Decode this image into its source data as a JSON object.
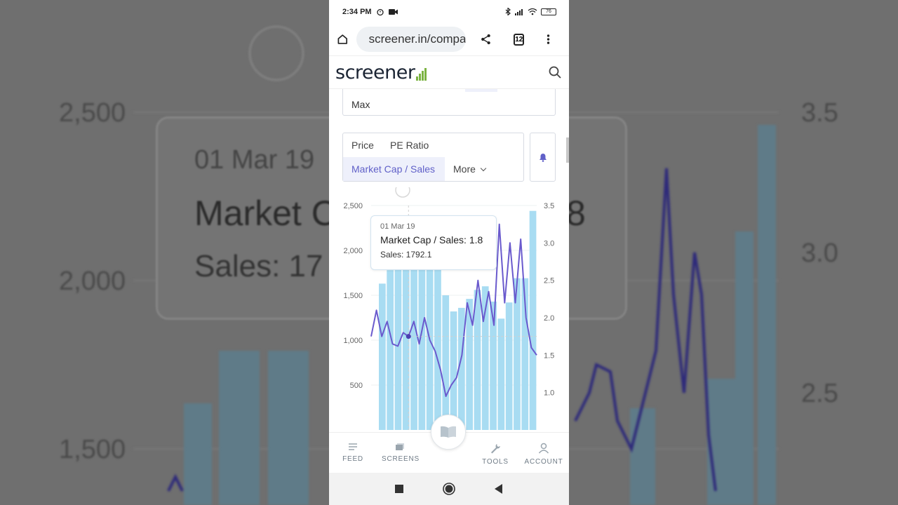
{
  "status_bar": {
    "time": "2:34 PM",
    "battery": "76"
  },
  "browser": {
    "url": "screener.in/company",
    "tab_count": "12"
  },
  "site": {
    "logo": "screener"
  },
  "filters": {
    "period_value": "Max",
    "metrics": [
      "Price",
      "PE Ratio",
      "Market Cap / Sales"
    ],
    "active_metric": "Market Cap / Sales",
    "more_label": "More"
  },
  "chart_data": {
    "type": "bar+line",
    "y_left_ticks": [
      "2,500",
      "2,000",
      "1,500",
      "1,000",
      "500"
    ],
    "y_right_ticks": [
      "3.5",
      "3.0",
      "2.5",
      "2.0",
      "1.5",
      "1.0"
    ],
    "ylim_left": [
      0,
      2500
    ],
    "ylim_right": [
      0.5,
      3.5
    ],
    "series": [
      {
        "name": "Sales",
        "type": "bar",
        "values": [
          1630,
          1780,
          1790,
          1785,
          1800,
          1830,
          1820,
          1800,
          1500,
          1320,
          1360,
          1460,
          1560,
          1600,
          1430,
          1240,
          1420,
          1690,
          1690,
          2440
        ]
      },
      {
        "name": "Market Cap / Sales",
        "type": "line",
        "values": [
          1.75,
          2.1,
          1.75,
          1.95,
          1.65,
          1.62,
          1.8,
          1.75,
          1.95,
          1.65,
          2.0,
          1.7,
          1.55,
          1.3,
          0.95,
          1.1,
          1.2,
          1.5,
          2.2,
          1.9,
          2.5,
          1.95,
          2.35,
          1.9,
          3.25,
          2.2,
          3.0,
          2.2,
          3.05,
          2.0,
          1.6,
          1.5
        ]
      }
    ],
    "tooltip": {
      "date": "01 Mar 19",
      "metric_line": "Market Cap / Sales: 1.8",
      "sales_line": "Sales: 1792.1"
    }
  },
  "bottom_nav": {
    "feed": "FEED",
    "screens": "SCREENS",
    "tools": "TOOLS",
    "account": "ACCOUNT"
  },
  "background": {
    "left_ticks": [
      "2,500",
      "2,000",
      "1,500"
    ],
    "right_ticks": [
      "3.5",
      "3.0",
      "2.5"
    ],
    "tooltip_date": "01 Mar 19",
    "tooltip_metric": "Market C",
    "tooltip_metric_tail": "8",
    "tooltip_sales": "Sales: 17"
  }
}
